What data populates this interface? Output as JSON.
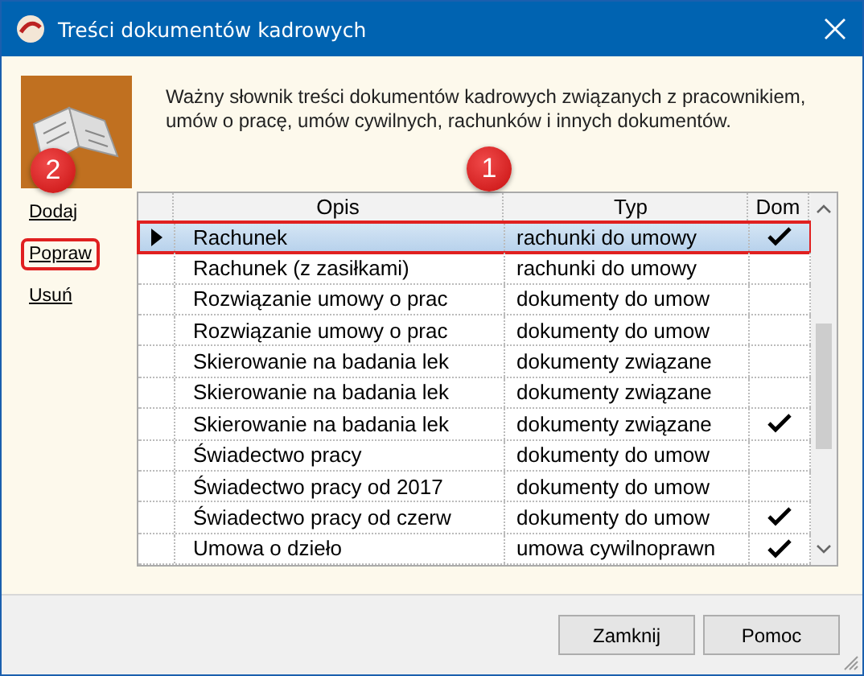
{
  "window": {
    "title": "Treści dokumentów kadrowych"
  },
  "description": "Ważny słownik treści dokumentów kadrowych związanych z pracownikiem, umów o pracę, umów cywilnych, rachunków i innych dokumentów.",
  "actions": [
    "Dodaj",
    "Popraw",
    "Usuń"
  ],
  "table": {
    "columns": [
      "Opis",
      "Typ",
      "Dom"
    ],
    "rows": [
      {
        "opis": "Rachunek",
        "typ": "rachunki do umowy",
        "dom": true,
        "selected": true
      },
      {
        "opis": "Rachunek (z zasiłkami)",
        "typ": "rachunki do umowy",
        "dom": false,
        "selected": false
      },
      {
        "opis": "Rozwiązanie umowy o prac",
        "typ": "dokumenty do umow",
        "dom": false,
        "selected": false
      },
      {
        "opis": "Rozwiązanie umowy o prac",
        "typ": "dokumenty do umow",
        "dom": false,
        "selected": false
      },
      {
        "opis": "Skierowanie na badania lek",
        "typ": "dokumenty związane",
        "dom": false,
        "selected": false
      },
      {
        "opis": "Skierowanie na badania lek",
        "typ": "dokumenty związane",
        "dom": false,
        "selected": false
      },
      {
        "opis": "Skierowanie na badania lek",
        "typ": "dokumenty związane",
        "dom": true,
        "selected": false
      },
      {
        "opis": "Świadectwo pracy",
        "typ": "dokumenty do umow",
        "dom": false,
        "selected": false
      },
      {
        "opis": "Świadectwo pracy od 2017",
        "typ": "dokumenty do umow",
        "dom": false,
        "selected": false
      },
      {
        "opis": "Świadectwo pracy od czerw",
        "typ": "dokumenty do umow",
        "dom": true,
        "selected": false
      },
      {
        "opis": "Umowa o dzieło",
        "typ": "umowa cywilnoprawn",
        "dom": true,
        "selected": false
      }
    ]
  },
  "buttons": [
    "Zamknij",
    "Pomoc"
  ],
  "annotations": [
    {
      "label": "2"
    },
    {
      "label": "1"
    }
  ]
}
